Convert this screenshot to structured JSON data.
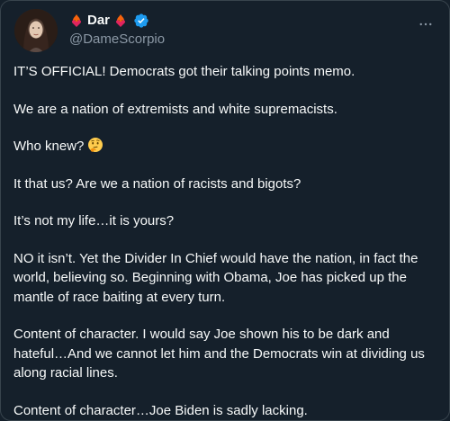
{
  "author": {
    "display_name": "Dar",
    "handle": "@DameScorpio",
    "verified": true,
    "name_emoji_left": "fire-heart-emoji",
    "name_emoji_right": "fire-heart-emoji"
  },
  "menu": {
    "more_icon": "ellipsis-icon"
  },
  "tweet": {
    "paragraphs": [
      "IT’S OFFICIAL! Democrats got their talking points memo.",
      "We are a nation of extremists and white supremacists.",
      "Who knew?",
      "It that us? Are we a nation of racists and bigots?",
      "It’s not my life…it is yours?",
      "NO it isn’t. Yet the Divider In Chief would have the nation, in fact the world, believing so. Beginning with Obama, Joe has picked up the mantle of race baiting at every turn.",
      "Content of character. I would say Joe shown his to be dark and hateful…And we cannot let him and the Democrats win at dividing us along racial lines.",
      "Content of character…Joe Biden is sadly lacking."
    ],
    "inline_emoji": "thinking-face-emoji"
  },
  "colors": {
    "background": "#15202b",
    "text": "#f7f9f9",
    "secondary_text": "#8b98a5",
    "verified_blue": "#1d9bf0",
    "border": "#38444d"
  }
}
